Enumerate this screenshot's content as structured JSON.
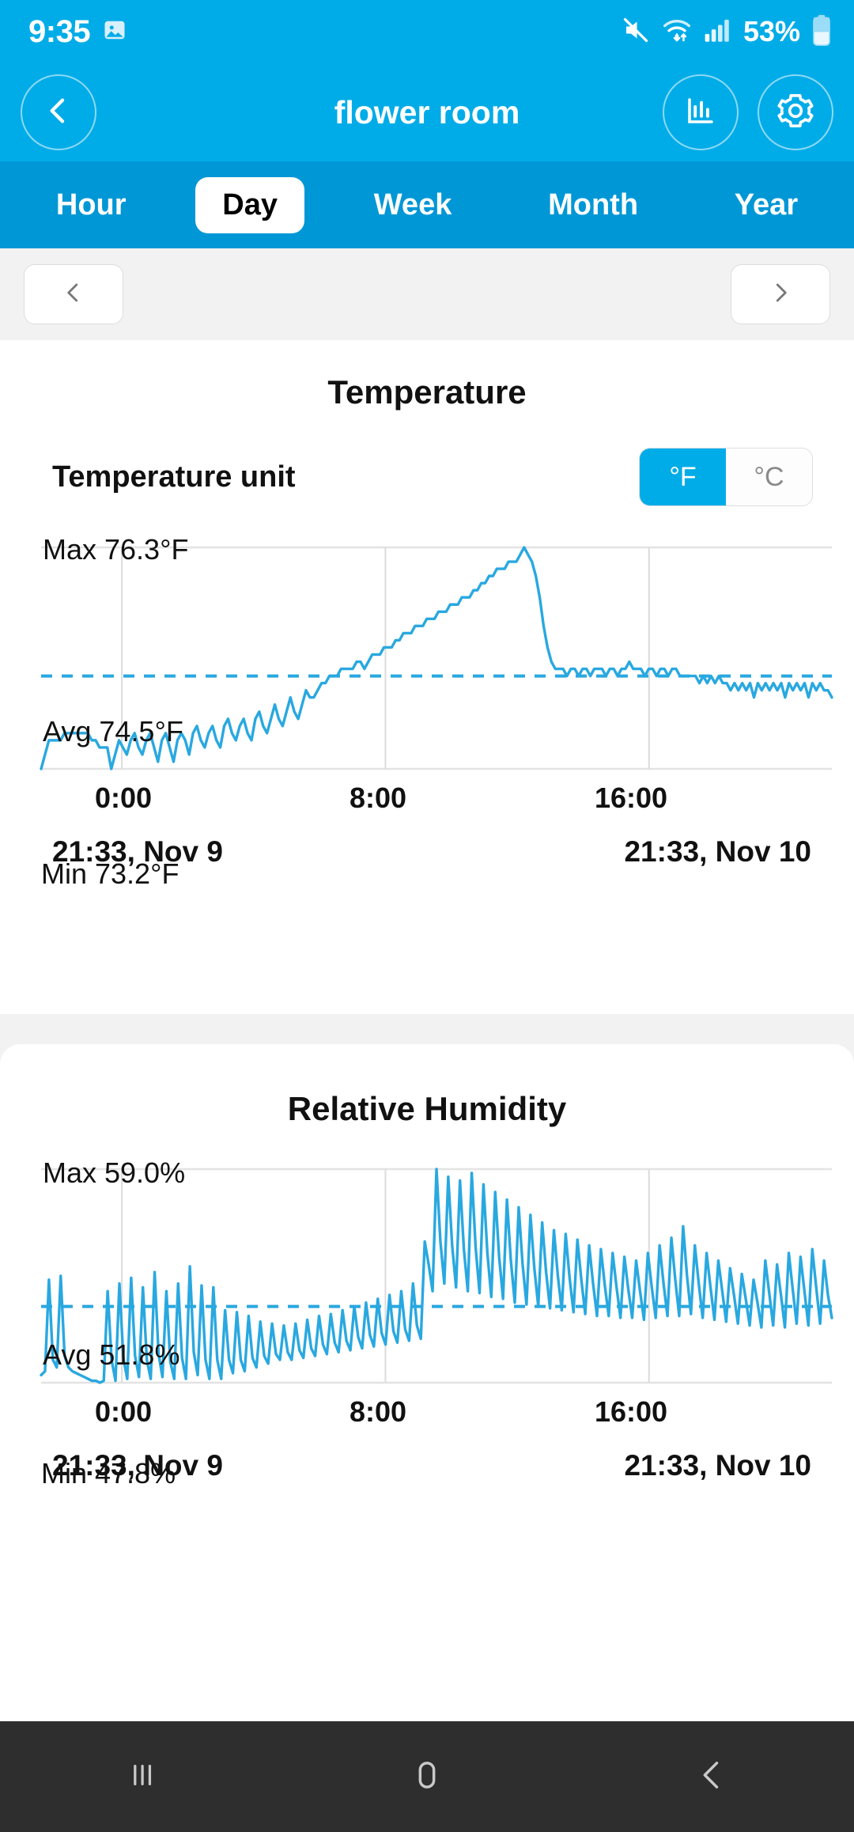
{
  "statusbar": {
    "time": "9:35",
    "battery_text": "53%",
    "icons": [
      "image-icon",
      "mute-icon",
      "wifi-icon",
      "signal-icon",
      "battery-icon"
    ]
  },
  "header": {
    "title": "flower room",
    "back_icon": "chevron-left-icon",
    "stats_icon": "bar-chart-icon",
    "settings_icon": "gear-icon"
  },
  "tabs": [
    {
      "label": "Hour",
      "active": false
    },
    {
      "label": "Day",
      "active": true
    },
    {
      "label": "Week",
      "active": false
    },
    {
      "label": "Month",
      "active": false
    },
    {
      "label": "Year",
      "active": false
    }
  ],
  "nav": {
    "prev_icon": "chevron-left-icon",
    "next_icon": "chevron-right-icon"
  },
  "temperature_card": {
    "title": "Temperature",
    "unit_label": "Temperature unit",
    "unit_options": [
      {
        "label": "°F",
        "selected": true
      },
      {
        "label": "°C",
        "selected": false
      }
    ],
    "max_label": "Max 76.3°F",
    "avg_label": "Avg 74.5°F",
    "min_label": "Min 73.2°F",
    "x_ticks": [
      "0:00",
      "8:00",
      "16:00"
    ],
    "range_start": "21:33, Nov 9",
    "range_end": "21:33, Nov 10"
  },
  "humidity_card": {
    "title": "Relative Humidity",
    "max_label": "Max 59.0%",
    "avg_label": "Avg 51.8%",
    "min_label": "Min 47.8%",
    "x_ticks": [
      "0:00",
      "8:00",
      "16:00"
    ],
    "range_start": "21:33, Nov 9",
    "range_end": "21:33, Nov 10"
  },
  "android_nav": {
    "recents_icon": "recents-icon",
    "home_icon": "home-icon",
    "back_icon": "back-icon"
  },
  "colors": {
    "brand_blue": "#00ace8",
    "tabbar_blue": "#0097d6",
    "chart_line": "#29a8e0",
    "page_bg": "#f2f2f2"
  },
  "chart_data": [
    {
      "type": "line",
      "title": "Temperature",
      "ylabel": "°F",
      "xlabel": "",
      "ylim": [
        73.2,
        76.3
      ],
      "xlim": [
        0,
        24
      ],
      "grid": true,
      "unit": "°F",
      "max": 76.3,
      "avg": 74.5,
      "min": 73.2,
      "x_tick_labels": [
        "0:00",
        "8:00",
        "16:00"
      ],
      "x_tick_hours": [
        2.45,
        10.45,
        18.45
      ],
      "range_start": "21:33, Nov 9",
      "range_end": "21:33, Nov 10",
      "avg_line": 74.5,
      "values": [
        73.2,
        73.4,
        73.6,
        73.6,
        73.6,
        73.6,
        73.7,
        73.7,
        73.7,
        73.7,
        73.7,
        73.7,
        73.7,
        73.6,
        73.6,
        73.5,
        73.5,
        73.5,
        73.2,
        73.4,
        73.6,
        73.5,
        73.4,
        73.6,
        73.7,
        73.5,
        73.4,
        73.6,
        73.7,
        73.5,
        73.3,
        73.6,
        73.7,
        73.5,
        73.3,
        73.6,
        73.7,
        73.6,
        73.4,
        73.7,
        73.8,
        73.6,
        73.5,
        73.7,
        73.8,
        73.6,
        73.5,
        73.8,
        73.9,
        73.7,
        73.6,
        73.8,
        73.9,
        73.7,
        73.6,
        73.9,
        74.0,
        73.8,
        73.7,
        73.9,
        74.1,
        73.9,
        73.8,
        74.0,
        74.2,
        74.0,
        73.9,
        74.1,
        74.3,
        74.2,
        74.2,
        74.3,
        74.4,
        74.4,
        74.5,
        74.5,
        74.5,
        74.6,
        74.6,
        74.6,
        74.6,
        74.7,
        74.7,
        74.6,
        74.7,
        74.8,
        74.8,
        74.8,
        74.9,
        74.9,
        74.9,
        75.0,
        75.0,
        75.1,
        75.1,
        75.1,
        75.2,
        75.2,
        75.2,
        75.3,
        75.3,
        75.3,
        75.4,
        75.4,
        75.4,
        75.5,
        75.5,
        75.5,
        75.6,
        75.6,
        75.6,
        75.7,
        75.7,
        75.8,
        75.8,
        75.9,
        75.9,
        76.0,
        76.0,
        76.0,
        76.1,
        76.1,
        76.1,
        76.2,
        76.3,
        76.2,
        76.1,
        75.9,
        75.6,
        75.2,
        74.9,
        74.7,
        74.6,
        74.6,
        74.6,
        74.5,
        74.6,
        74.6,
        74.5,
        74.6,
        74.6,
        74.5,
        74.6,
        74.6,
        74.6,
        74.5,
        74.6,
        74.6,
        74.5,
        74.6,
        74.6,
        74.7,
        74.6,
        74.6,
        74.6,
        74.5,
        74.6,
        74.6,
        74.5,
        74.6,
        74.6,
        74.5,
        74.6,
        74.6,
        74.5,
        74.5,
        74.5,
        74.5,
        74.5,
        74.4,
        74.5,
        74.4,
        74.5,
        74.4,
        74.5,
        74.4,
        74.4,
        74.3,
        74.4,
        74.3,
        74.4,
        74.3,
        74.4,
        74.2,
        74.4,
        74.3,
        74.4,
        74.3,
        74.4,
        74.3,
        74.4,
        74.2,
        74.4,
        74.3,
        74.4,
        74.3,
        74.4,
        74.2,
        74.4,
        74.3,
        74.4,
        74.3,
        74.3,
        74.2
      ]
    },
    {
      "type": "line",
      "title": "Relative Humidity",
      "ylabel": "%",
      "xlabel": "",
      "ylim": [
        47.8,
        59.0
      ],
      "xlim": [
        0,
        24
      ],
      "grid": true,
      "unit": "%",
      "max": 59.0,
      "avg": 51.8,
      "min": 47.8,
      "x_tick_labels": [
        "0:00",
        "8:00",
        "16:00"
      ],
      "x_tick_hours": [
        2.45,
        10.45,
        18.45
      ],
      "range_start": "21:33, Nov 9",
      "range_end": "21:33, Nov 10",
      "avg_line": 51.8,
      "values": [
        48.2,
        48.4,
        53.2,
        49.0,
        48.6,
        53.4,
        49.2,
        48.6,
        48.4,
        48.3,
        48.2,
        48.1,
        48.0,
        47.9,
        47.9,
        47.8,
        47.9,
        52.6,
        49.0,
        47.9,
        53.0,
        49.1,
        48.0,
        53.3,
        49.2,
        48.1,
        52.8,
        49.0,
        48.0,
        53.6,
        49.3,
        48.1,
        52.6,
        48.9,
        48.0,
        53.0,
        49.1,
        48.0,
        53.9,
        49.4,
        48.2,
        52.9,
        49.0,
        48.0,
        52.8,
        49.0,
        48.0,
        51.6,
        49.0,
        48.3,
        51.5,
        49.0,
        48.4,
        51.3,
        49.1,
        48.6,
        51.0,
        49.2,
        48.8,
        50.9,
        49.3,
        49.0,
        50.8,
        49.4,
        49.0,
        50.9,
        49.5,
        49.1,
        51.1,
        49.6,
        49.2,
        51.3,
        49.8,
        49.3,
        51.4,
        49.9,
        49.4,
        51.6,
        50.0,
        49.5,
        51.8,
        50.2,
        49.6,
        52.0,
        50.3,
        49.7,
        52.2,
        50.4,
        49.8,
        52.4,
        50.5,
        49.9,
        52.6,
        50.6,
        50.0,
        53.0,
        50.8,
        50.1,
        55.2,
        54.0,
        52.6,
        59.0,
        55.2,
        53.0,
        58.6,
        55.0,
        52.8,
        58.4,
        54.8,
        52.6,
        58.8,
        54.9,
        52.5,
        58.2,
        54.6,
        52.3,
        57.8,
        54.4,
        52.2,
        57.4,
        54.2,
        52.0,
        57.0,
        54.0,
        51.9,
        56.6,
        53.8,
        51.8,
        56.2,
        53.6,
        51.7,
        55.8,
        53.4,
        51.6,
        55.6,
        53.3,
        51.5,
        55.3,
        53.2,
        51.4,
        55.0,
        53.0,
        51.3,
        54.8,
        52.9,
        51.3,
        54.6,
        52.8,
        51.2,
        54.4,
        52.7,
        51.2,
        54.2,
        52.6,
        51.1,
        54.6,
        52.8,
        51.2,
        55.0,
        53.0,
        51.3,
        55.4,
        53.2,
        51.3,
        56.0,
        53.4,
        51.4,
        55.0,
        53.0,
        51.2,
        54.6,
        52.8,
        51.1,
        54.2,
        52.6,
        51.0,
        53.8,
        52.4,
        50.9,
        53.5,
        52.2,
        50.8,
        53.2,
        52.0,
        50.7,
        54.2,
        52.5,
        50.8,
        54.0,
        52.4,
        50.7,
        54.6,
        52.7,
        50.9,
        54.4,
        52.6,
        50.8,
        54.8,
        52.8,
        50.9,
        54.2,
        52.4,
        51.2
      ]
    }
  ]
}
